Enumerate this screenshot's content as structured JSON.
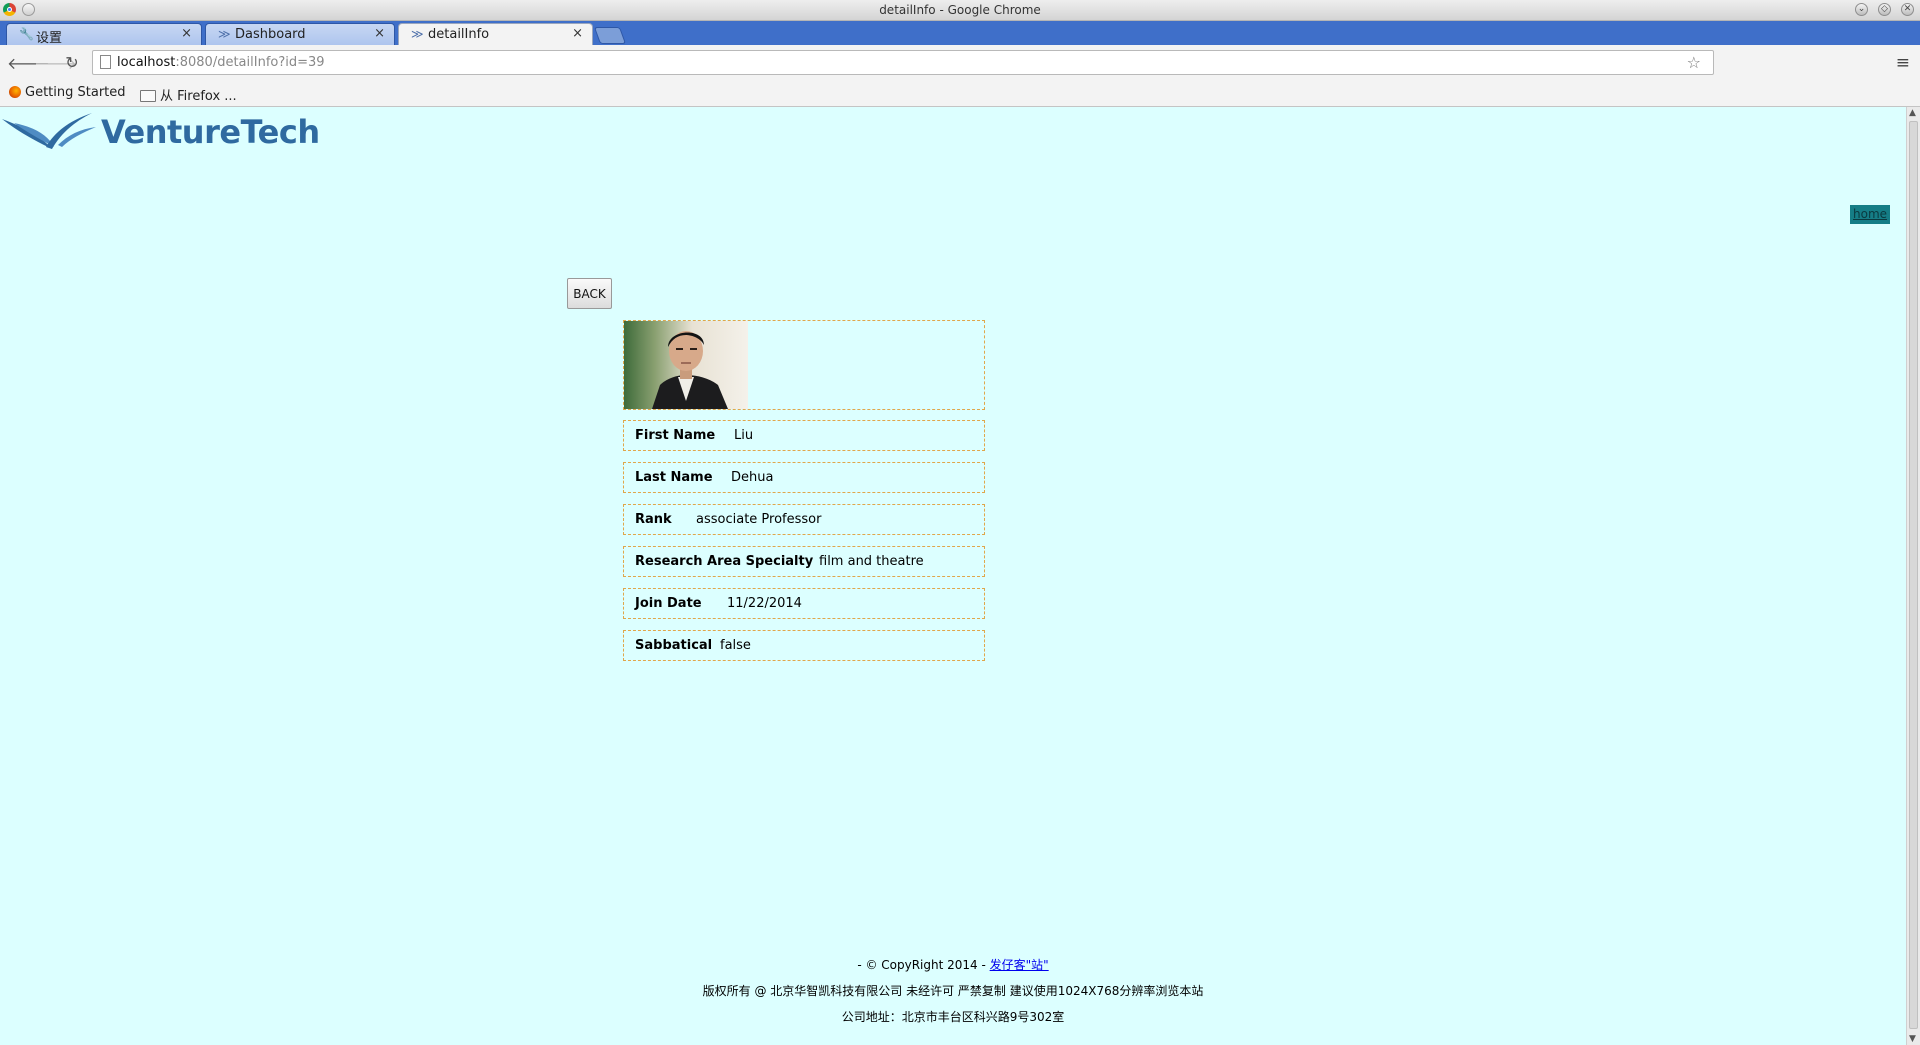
{
  "window": {
    "title": "detailInfo - Google Chrome"
  },
  "tabs": [
    {
      "label": "设置",
      "icon": "wrench-icon",
      "active": false
    },
    {
      "label": "Dashboard",
      "icon": "venturetech-favicon",
      "active": false
    },
    {
      "label": "detailInfo",
      "icon": "venturetech-favicon",
      "active": true
    }
  ],
  "omnibox": {
    "host": "localhost",
    "path": ":8080/detailInfo?id=39"
  },
  "bookmarks": [
    {
      "label": "Getting Started",
      "icon": "firefox-icon"
    },
    {
      "label": "从 Firefox ...",
      "icon": "folder-icon"
    }
  ],
  "page": {
    "logo_text": "VentureTech",
    "home_link": "home",
    "back_label": "BACK",
    "fields": [
      {
        "label": "First Name",
        "value": "Liu"
      },
      {
        "label": "Last Name",
        "value": "Dehua"
      },
      {
        "label": "Rank",
        "value": "associate Professor"
      },
      {
        "label": "Research Area Specialty",
        "value": "film and theatre"
      },
      {
        "label": "Join Date",
        "value": "11/22/2014"
      },
      {
        "label": "Sabbatical",
        "value": "false"
      }
    ]
  },
  "footer": {
    "copyright_prefix": "- © CopyRight 2014 - ",
    "copyright_link": "发仔客\"站\"",
    "line2": "版权所有 @ 北京华智凯科技有限公司 未经许可 严禁复制 建议使用1024X768分辨率浏览本站",
    "line3": "公司地址：北京市丰台区科兴路9号302室"
  },
  "colors": {
    "page_background": "#dcffff",
    "field_border": "#e0a64a",
    "logo_blue": "#2f6aa0",
    "home_link_bg": "#157d86",
    "tabstrip": "#3f6fc9"
  }
}
